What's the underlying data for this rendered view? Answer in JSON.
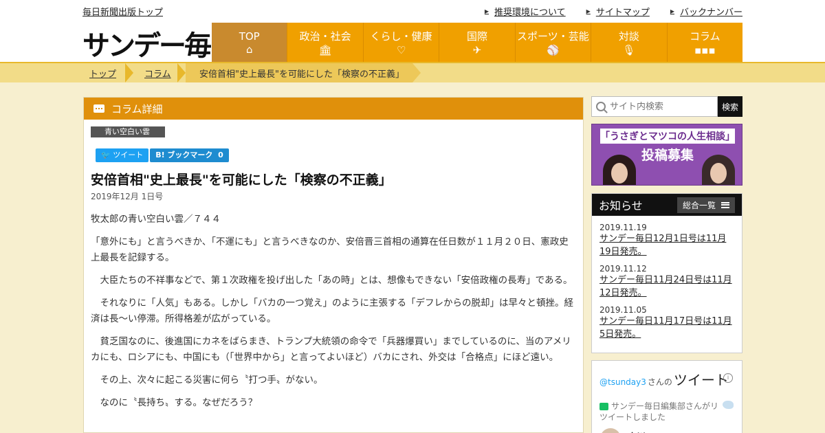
{
  "header": {
    "top_link": "毎日新聞出版トップ",
    "util_links": [
      "推奨環境について",
      "サイトマップ",
      "バックナンバー"
    ],
    "logo": "サンデー毎日"
  },
  "nav": [
    {
      "label": "TOP",
      "icon": "home-icon",
      "glyph": "⌂"
    },
    {
      "label": "政治・社会",
      "icon": "building-icon",
      "glyph": "🏛"
    },
    {
      "label": "くらし・健康",
      "icon": "heart-icon",
      "glyph": "♡"
    },
    {
      "label": "国際",
      "icon": "airplane-icon",
      "glyph": "✈"
    },
    {
      "label": "スポーツ・芸能",
      "icon": "sports-icon",
      "glyph": "⚾"
    },
    {
      "label": "対談",
      "icon": "microphone-icon",
      "glyph": "🎙"
    },
    {
      "label": "コラム",
      "icon": "chat-bubble-icon",
      "glyph": "▪▪▪"
    }
  ],
  "breadcrumb": [
    "トップ",
    "コラム",
    "安倍首相\"史上最長\"を可能にした「検察の不正義」"
  ],
  "section_title": "コラム詳細",
  "category_tag": "青い空白い雲",
  "share": {
    "tweet": "ツイート",
    "hatena": "B! ブックマーク",
    "hatena_count": "0"
  },
  "article": {
    "title": "安倍首相\"史上最長\"を可能にした「検察の不正義」",
    "date": "2019年12月 1日号",
    "paragraphs": [
      "牧太郎の青い空白い雲／７４４",
      "「意外にも」と言うべきか、「不運にも」と言うべきなのか、安倍晋三首相の通算在任日数が１１月２０日、憲政史上最長を記録する。",
      "　大臣たちの不祥事などで、第１次政権を投げ出した「あの時」とは、想像もできない「安倍政権の長寿」である。",
      "　それなりに「人気」もある。しかし「バカの一つ覚え」のように主張する「デフレからの脱却」は早々と頓挫。経済は長〜い停滞。所得格差が広がっている。",
      "　貧乏国なのに、後進国にカネをばらまき、トランプ大統領の命令で「兵器爆買い」までしているのに、当のアメリカにも、ロシアにも、中国にも（「世界中から」と言ってよいほど）バカにされ、外交は「合格点」にほど遠い。",
      "　その上、次々に起こる災害に何ら〝打つ手〟がない。",
      "　なのに〝長持ち〟する。なぜだろう？"
    ]
  },
  "search": {
    "placeholder": "サイト内検索",
    "button": "検索"
  },
  "banner": {
    "title": "「うさぎとマツコの人生相談」",
    "subtitle": "投稿募集"
  },
  "news": {
    "title": "お知らせ",
    "all_label": "総合一覧",
    "items": [
      {
        "date": "2019.11.19",
        "text": "サンデー毎日12月1日号は11月19日発売。"
      },
      {
        "date": "2019.11.12",
        "text": "サンデー毎日11月24日号は11月12日発売。"
      },
      {
        "date": "2019.11.05",
        "text": "サンデー毎日11月17日号は11月5日発売。"
      }
    ]
  },
  "twitter": {
    "handle": "@tsunday3",
    "suffix": "さんの",
    "heading": "ツイート",
    "retweet_text": "サンデー毎日編集部さんがリツイートしました",
    "user_name": "小川"
  }
}
